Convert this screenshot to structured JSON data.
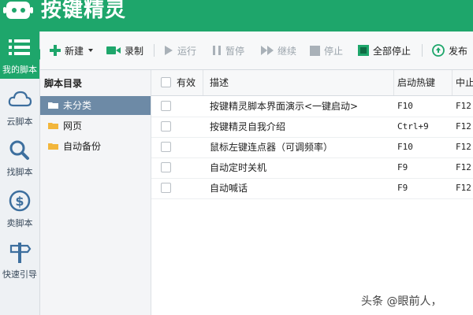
{
  "app": {
    "title": "按键精灵"
  },
  "nav": {
    "items": [
      {
        "label": "我的脚本",
        "icon": "list-icon"
      },
      {
        "label": "云脚本",
        "icon": "cloud-icon"
      },
      {
        "label": "找脚本",
        "icon": "search-icon"
      },
      {
        "label": "卖脚本",
        "icon": "dollar-icon"
      },
      {
        "label": "快速引导",
        "icon": "signpost-icon"
      }
    ]
  },
  "toolbar": {
    "new_label": "新建",
    "record_label": "录制",
    "run_label": "运行",
    "pause_label": "暂停",
    "continue_label": "继续",
    "stop_label": "停止",
    "stop_all_label": "全部停止",
    "publish_label": "发布"
  },
  "tree": {
    "header": "脚本目录",
    "items": [
      {
        "label": "未分类",
        "selected": true
      },
      {
        "label": "网页",
        "selected": false
      },
      {
        "label": "自动备份",
        "selected": false
      }
    ]
  },
  "table": {
    "headers": {
      "enabled": "有效",
      "desc": "描述",
      "hotkey": "启动热键",
      "stop": "中止"
    },
    "rows": [
      {
        "desc": "按键精灵脚本界面演示<一键启动>",
        "hotkey": "F10",
        "stop": "F12"
      },
      {
        "desc": "按键精灵自我介绍",
        "hotkey": "Ctrl+9",
        "stop": "F12"
      },
      {
        "desc": "鼠标左键连点器（可调频率）",
        "hotkey": "F10",
        "stop": "F12"
      },
      {
        "desc": "自动定时关机",
        "hotkey": "F9",
        "stop": "F12"
      },
      {
        "desc": "自动喊话",
        "hotkey": "F9",
        "stop": "F12"
      }
    ]
  },
  "watermark": "头条 @眼前人，",
  "colors": {
    "brand_green": "#1ea66b",
    "selected_row": "#6d8aa6",
    "folder_yellow": "#f2b63c"
  }
}
